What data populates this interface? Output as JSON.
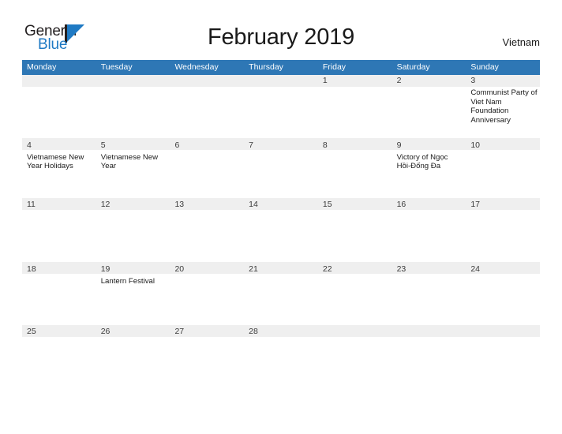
{
  "logo": {
    "word_one": "General",
    "word_two": "Blue",
    "mark": "sail-triangle",
    "color_dark": "#231f20",
    "color_blue": "#1f7ac4"
  },
  "header": {
    "title": "February 2019",
    "country": "Vietnam"
  },
  "theme": {
    "header_blue": "#2e77b5",
    "separator_blue": "#2e77b5",
    "day_band_gray": "#efefef",
    "text_dark": "#1a1a1a"
  },
  "calendar": {
    "weekdays": [
      "Monday",
      "Tuesday",
      "Wednesday",
      "Thursday",
      "Friday",
      "Saturday",
      "Sunday"
    ],
    "weeks": [
      {
        "days": [
          {
            "number": "",
            "events": []
          },
          {
            "number": "",
            "events": []
          },
          {
            "number": "",
            "events": []
          },
          {
            "number": "",
            "events": []
          },
          {
            "number": "1",
            "events": []
          },
          {
            "number": "2",
            "events": []
          },
          {
            "number": "3",
            "events": [
              "Communist Party of Viet Nam Foundation Anniversary"
            ]
          }
        ]
      },
      {
        "days": [
          {
            "number": "4",
            "events": [
              "Vietnamese New Year Holidays"
            ]
          },
          {
            "number": "5",
            "events": [
              "Vietnamese New Year"
            ]
          },
          {
            "number": "6",
            "events": []
          },
          {
            "number": "7",
            "events": []
          },
          {
            "number": "8",
            "events": []
          },
          {
            "number": "9",
            "events": [
              "Victory of Ngọc Hồi-Đống Đa"
            ]
          },
          {
            "number": "10",
            "events": []
          }
        ]
      },
      {
        "days": [
          {
            "number": "11",
            "events": []
          },
          {
            "number": "12",
            "events": []
          },
          {
            "number": "13",
            "events": []
          },
          {
            "number": "14",
            "events": []
          },
          {
            "number": "15",
            "events": []
          },
          {
            "number": "16",
            "events": []
          },
          {
            "number": "17",
            "events": []
          }
        ]
      },
      {
        "days": [
          {
            "number": "18",
            "events": []
          },
          {
            "number": "19",
            "events": [
              "Lantern Festival"
            ]
          },
          {
            "number": "20",
            "events": []
          },
          {
            "number": "21",
            "events": []
          },
          {
            "number": "22",
            "events": []
          },
          {
            "number": "23",
            "events": []
          },
          {
            "number": "24",
            "events": []
          }
        ]
      },
      {
        "days": [
          {
            "number": "25",
            "events": []
          },
          {
            "number": "26",
            "events": []
          },
          {
            "number": "27",
            "events": []
          },
          {
            "number": "28",
            "events": []
          },
          {
            "number": "",
            "events": []
          },
          {
            "number": "",
            "events": []
          },
          {
            "number": "",
            "events": []
          }
        ]
      }
    ],
    "week_heights": [
      80,
      74,
      80,
      78,
      45
    ]
  }
}
